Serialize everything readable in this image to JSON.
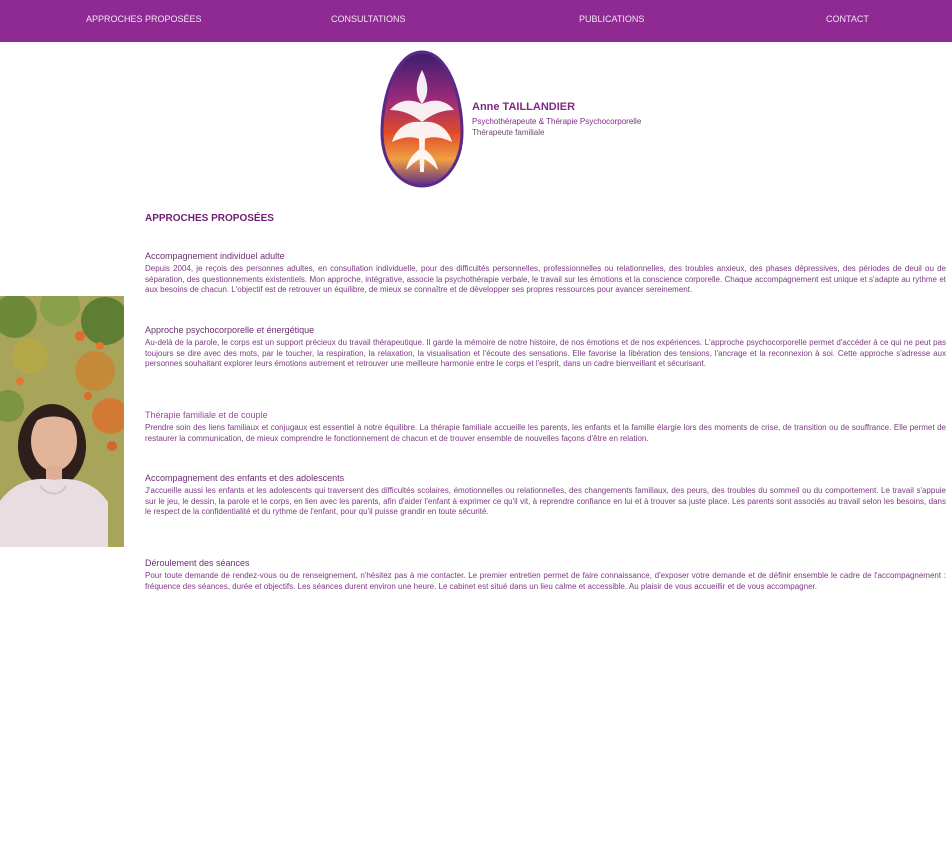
{
  "nav": {
    "items": [
      {
        "label": "APPROCHES PROPOSÉES"
      },
      {
        "label": "CONSULTATIONS"
      },
      {
        "label": "PUBLICATIONS"
      },
      {
        "label": "CONTACT"
      }
    ]
  },
  "brand": {
    "name": "Anne TAILLANDIER",
    "subtitle1": "Psychothérapeute & Thérapie Psychocorporelle",
    "subtitle2": "Thérapeute familiale"
  },
  "colors": {
    "nav_bg": "#8e2a92",
    "accent": "#7d2a84",
    "heading": "#6e1f73"
  },
  "icons": {
    "logo": "phoenix-egg-logo",
    "photo": "portrait-photo"
  },
  "content": {
    "heading": "APPROCHES PROPOSÉES",
    "sections": [
      {
        "title": "Accompagnement individuel adulte",
        "body": "Depuis 2004, je reçois des personnes adultes, en consultation individuelle, pour des difficultés personnelles, professionnelles ou relationnelles, des troubles anxieux, des phases dépressives, des périodes de deuil ou de séparation, des questionnements existentiels. Mon approche, intégrative, associe la psychothérapie verbale, le travail sur les émotions et la conscience corporelle. Chaque accompagnement est unique et s'adapte au rythme et aux besoins de chacun. L'objectif est de retrouver un équilibre, de mieux se connaître et de développer ses propres ressources pour avancer sereinement."
      },
      {
        "title": "Approche psychocorporelle et énergétique",
        "body": "Au-delà de la parole, le corps est un support précieux du travail thérapeutique. Il garde la mémoire de notre histoire, de nos émotions et de nos expériences. L'approche psychocorporelle permet d'accéder à ce qui ne peut pas toujours se dire avec des mots, par le toucher, la respiration, la relaxation, la visualisation et l'écoute des sensations. Elle favorise la libération des tensions, l'ancrage et la reconnexion à soi. Cette approche s'adresse aux personnes souhaitant explorer leurs émotions autrement et retrouver une meilleure harmonie entre le corps et l'esprit, dans un cadre bienveillant et sécurisant."
      },
      {
        "title": "Thérapie familiale et de couple",
        "body": "Prendre soin des liens familiaux et conjugaux est essentiel à notre équilibre. La thérapie familiale accueille les parents, les enfants et la famille élargie lors des moments de crise, de transition ou de souffrance. Elle permet de restaurer la communication, de mieux comprendre le fonctionnement de chacun et de trouver ensemble de nouvelles façons d'être en relation."
      },
      {
        "title": "Accompagnement des enfants et des adolescents",
        "body": "J'accueille aussi les enfants et les adolescents qui traversent des difficultés scolaires, émotionnelles ou relationnelles, des changements familiaux, des peurs, des troubles du sommeil ou du comportement. Le travail s'appuie sur le jeu, le dessin, la parole et le corps, en lien avec les parents, afin d'aider l'enfant à exprimer ce qu'il vit, à reprendre confiance en lui et à trouver sa juste place. Les parents sont associés au travail selon les besoins, dans le respect de la confidentialité et du rythme de l'enfant, pour qu'il puisse grandir en toute sécurité."
      },
      {
        "title": "Déroulement des séances",
        "body": "Pour toute demande de rendez-vous ou de renseignement, n'hésitez pas à me contacter. Le premier entretien permet de faire connaissance, d'exposer votre demande et de définir ensemble le cadre de l'accompagnement : fréquence des séances, durée et objectifs. Les séances durent environ une heure. Le cabinet est situé dans un lieu calme et accessible. Au plaisir de vous accueillir et de vous accompagner."
      }
    ]
  }
}
